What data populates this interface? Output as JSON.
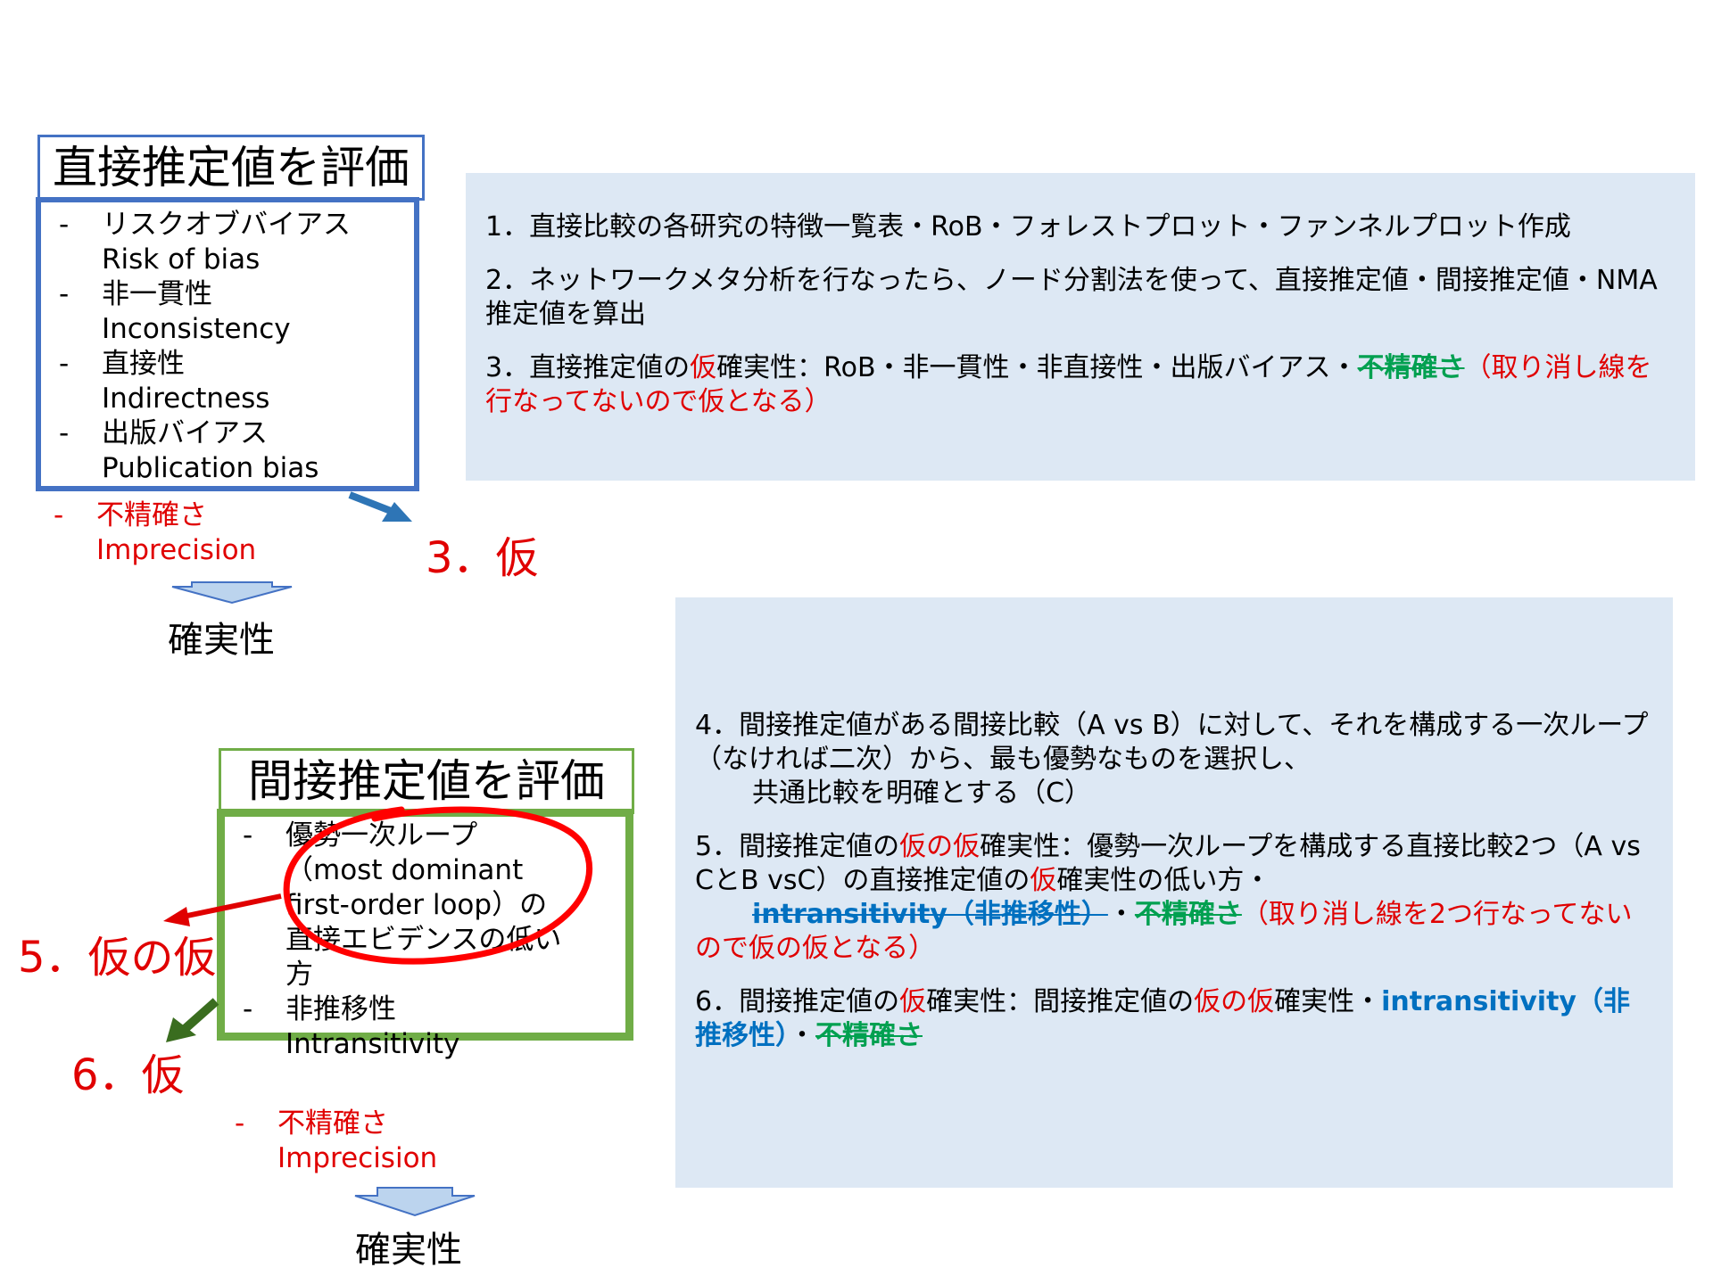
{
  "direct": {
    "title": "直接推定値を評価",
    "items": [
      {
        "jp": "リスクオブバイアス",
        "en": "Risk of bias"
      },
      {
        "jp": "非一貫性",
        "en": "Inconsistency"
      },
      {
        "jp": "直接性",
        "en": "Indirectness"
      },
      {
        "jp": "出版バイアス",
        "en": "Publication bias"
      }
    ],
    "imprecision": {
      "jp": "不精確さ",
      "en": "Imprecision"
    },
    "certainty": "確実性",
    "arrow_label": "3．仮"
  },
  "indirect": {
    "title": "間接推定値を評価",
    "items": [
      {
        "text": "優勢一次ループ（most dominant first-order loop）の直接エビデンスの低い方"
      },
      {
        "jp": "非推移性",
        "en": "Intransitivity"
      }
    ],
    "imprecision": {
      "jp": "不精確さ",
      "en": "Imprecision"
    },
    "certainty": "確実性",
    "label5": "5．仮の仮",
    "label6": "6．仮"
  },
  "panel1": {
    "step1": "1．直接比較の各研究の特徴一覧表・RoB・フォレストプロット・ファンネルプロット作成",
    "step2": "2．ネットワークメタ分析を行なったら、ノード分割法を使って、直接推定値・間接推定値・NMA推定値を算出",
    "step3": {
      "a": "3．直接推定値の",
      "b": "仮",
      "c": "確実性：RoB・非一貫性・非直接性・出版バイアス・",
      "d": "不精確さ",
      "e": "（取り消し線を行なってないので仮となる）"
    }
  },
  "panel2": {
    "step4": {
      "a": "4．間接推定値がある間接比較（A vs B）に対して、それを構成する一次ループ（なければ二次）から、最も優勢なものを選択し、",
      "b": "共通比較を明確とする（C）"
    },
    "step5": {
      "a": "5．間接推定値の",
      "b": "仮の仮",
      "c": "確実性：優勢一次ループを構成する直接比較2つ（A vs CとB vsC）の直接推定値の",
      "d": "仮",
      "e": "確実性の低い方・",
      "f": "intransitivity（非推移性）",
      "g": "・",
      "h": "不精確さ",
      "i": "（取り消し線を2つ行なってないので仮の仮となる）"
    },
    "step6": {
      "a": "6．間接推定値の",
      "b": "仮",
      "c": "確実性：間接推定値の",
      "d": "仮の仮",
      "e": "確実性・",
      "f": "intransitivity（非推移性）",
      "g": "・",
      "h": "不精確さ"
    }
  },
  "colors": {
    "blue_box": "#4472c4",
    "green_box": "#70ad47",
    "panel": "#dde8f4",
    "red": "#e00000",
    "green_text": "#00a050",
    "blue_text": "#0070c0",
    "circle": "#ff0000"
  }
}
